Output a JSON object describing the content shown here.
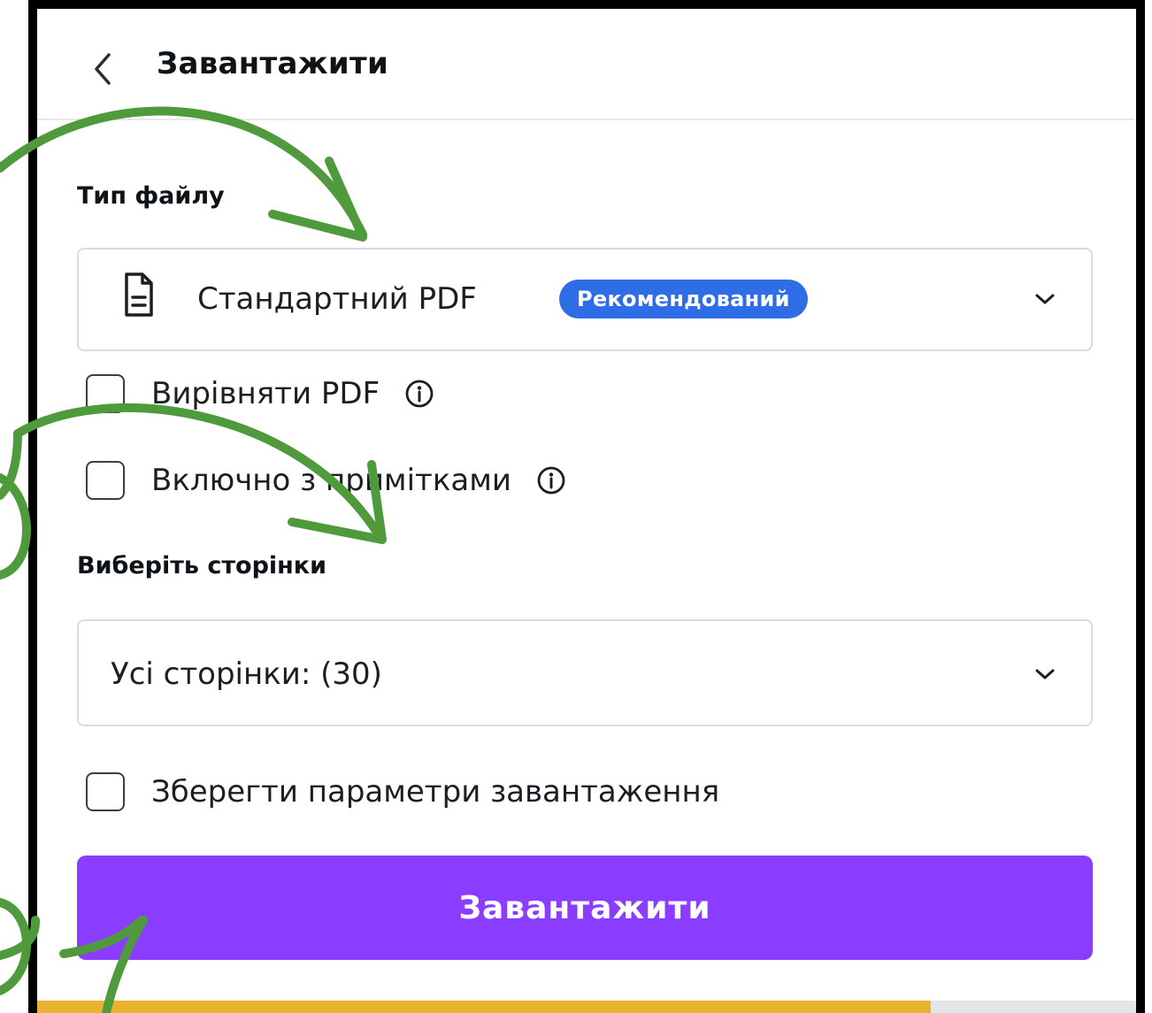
{
  "header": {
    "title": "Завантажити",
    "back_icon": "chevron-left-icon"
  },
  "file_type": {
    "label": "Тип файлу",
    "selected": "Стандартний PDF",
    "badge": "Рекомендований",
    "icon": "document-icon",
    "badge_color": "#2f6de6"
  },
  "options": {
    "flatten_pdf": {
      "label": "Вирівняти PDF",
      "checked": false
    },
    "include_notes": {
      "label": "Включно з примітками",
      "checked": false
    }
  },
  "pages": {
    "label": "Виберіть сторінки",
    "selected": "Усі сторінки: (30)"
  },
  "save_settings": {
    "label": "Зберегти параметри завантаження",
    "checked": false
  },
  "download_button": {
    "label": "Завантажити",
    "color": "#8b3dff"
  },
  "annotation_color": "#4f9a3c"
}
